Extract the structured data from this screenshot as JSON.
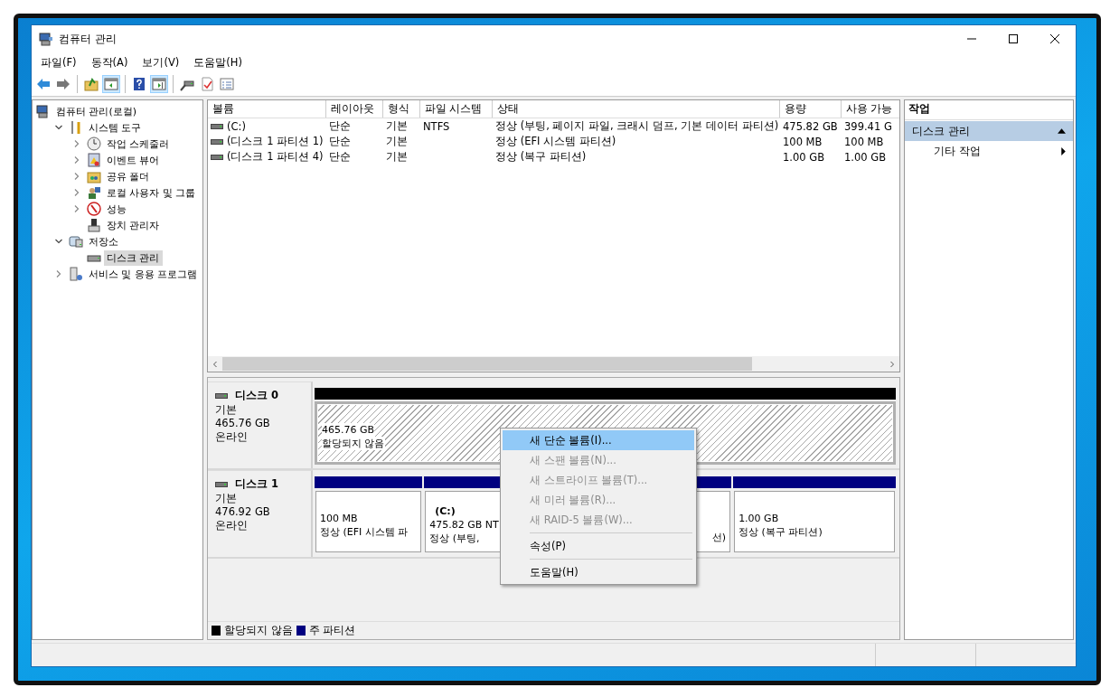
{
  "window": {
    "title": "컴퓨터 관리"
  },
  "menu_bar": [
    "파일(F)",
    "동작(A)",
    "보기(V)",
    "도움말(H)"
  ],
  "toolbar": [
    [
      {
        "kind": "back",
        "pressed": false
      },
      {
        "kind": "forward",
        "pressed": false
      }
    ],
    [
      {
        "kind": "up",
        "pressed": false
      },
      {
        "kind": "tree-pane",
        "pressed": true
      }
    ],
    [
      {
        "kind": "help",
        "pressed": false
      },
      {
        "kind": "action-pane",
        "pressed": true
      }
    ],
    [
      {
        "kind": "connect",
        "pressed": false
      },
      {
        "kind": "check",
        "pressed": false
      },
      {
        "kind": "properties",
        "pressed": false
      }
    ]
  ],
  "tree": [
    {
      "label": "컴퓨터 관리(로컬)",
      "kind": "computer",
      "selected": false,
      "children": [
        {
          "label": "시스템 도구",
          "kind": "tools",
          "expanded": true,
          "selected": false,
          "children": [
            {
              "label": "작업 스케줄러",
              "kind": "clock",
              "expanded": false,
              "selected": false
            },
            {
              "label": "이벤트 뷰어",
              "kind": "event",
              "expanded": false,
              "selected": false
            },
            {
              "label": "공유 폴더",
              "kind": "share",
              "expanded": false,
              "selected": false
            },
            {
              "label": "로컬 사용자 및 그룹",
              "kind": "users",
              "expanded": false,
              "selected": false
            },
            {
              "label": "성능",
              "kind": "performance",
              "expanded": false,
              "selected": false
            },
            {
              "label": "장치 관리자",
              "kind": "device",
              "selected": false
            }
          ]
        },
        {
          "label": "저장소",
          "kind": "storage",
          "expanded": true,
          "selected": false,
          "children": [
            {
              "label": "디스크 관리",
              "kind": "disk",
              "selected": true
            }
          ]
        },
        {
          "label": "서비스 및 응용 프로그램",
          "kind": "services",
          "expanded": false,
          "selected": false
        }
      ]
    }
  ],
  "volume_list": {
    "columns": [
      "볼륨",
      "레이아웃",
      "형식",
      "파일 시스템",
      "상태",
      "용량",
      "사용 가능"
    ],
    "rows": [
      {
        "volume": "(C:)",
        "layout": "단순",
        "type": "기본",
        "file_system": "NTFS",
        "status": "정상 (부팅, 페이지 파일, 크래시 덤프, 기본 데이터 파티션)",
        "capacity": "475.82 GB",
        "free": "399.41 G"
      },
      {
        "volume": "(디스크 1 파티션 1)",
        "layout": "단순",
        "type": "기본",
        "status": "정상 (EFI 시스템 파티션)",
        "capacity": "100 MB",
        "free": "100 MB"
      },
      {
        "volume": "(디스크 1 파티션 4)",
        "layout": "단순",
        "type": "기본",
        "status": "정상 (복구 파티션)",
        "capacity": "1.00 GB",
        "free": "1.00 GB"
      }
    ]
  },
  "disks": [
    {
      "name": "디스크 0",
      "type": "기본",
      "size": "465.76 GB",
      "status": "온라인",
      "partitions": [
        {
          "kind": "unallocated",
          "selected": true,
          "size": "465.76 GB",
          "status": "할당되지 않음"
        }
      ]
    },
    {
      "name": "디스크 1",
      "type": "기본",
      "size": "476.92 GB",
      "status": "온라인",
      "partitions": [
        {
          "kind": "primary",
          "selected": false,
          "size": "100 MB",
          "status": "정상 (EFI 시스템 파"
        },
        {
          "kind": "primary",
          "selected": false,
          "label": "(C:)",
          "size": "475.82 GB NT",
          "status": "정상 (부팅,",
          "tail": "선)"
        },
        {
          "kind": "primary",
          "selected": false,
          "size": "1.00 GB",
          "status": "정상 (복구 파티션)"
        }
      ]
    }
  ],
  "legend": [
    {
      "label": "할당되지 않음",
      "color": "#000000"
    },
    {
      "label": "주 파티션",
      "color": "#000080"
    }
  ],
  "actions": {
    "title": "작업",
    "sections": [
      {
        "title": "디스크 관리",
        "expanded": true,
        "items": [
          {
            "label": "기타 작업",
            "submenu": true
          }
        ]
      }
    ]
  },
  "context_menu": {
    "groups": [
      [
        {
          "label": "새 단순 볼륨(I)...",
          "disabled": false,
          "selected": true
        },
        {
          "label": "새 스팬 볼륨(N)...",
          "disabled": true,
          "selected": false
        },
        {
          "label": "새 스트라이프 볼륨(T)...",
          "disabled": true,
          "selected": false
        },
        {
          "label": "새 미러 볼륨(R)...",
          "disabled": true,
          "selected": false
        },
        {
          "label": "새 RAID-5 볼륨(W)...",
          "disabled": true,
          "selected": false
        }
      ],
      [
        {
          "label": "속성(P)",
          "disabled": false,
          "selected": false
        }
      ],
      [
        {
          "label": "도움말(H)",
          "disabled": false,
          "selected": false
        }
      ]
    ]
  }
}
